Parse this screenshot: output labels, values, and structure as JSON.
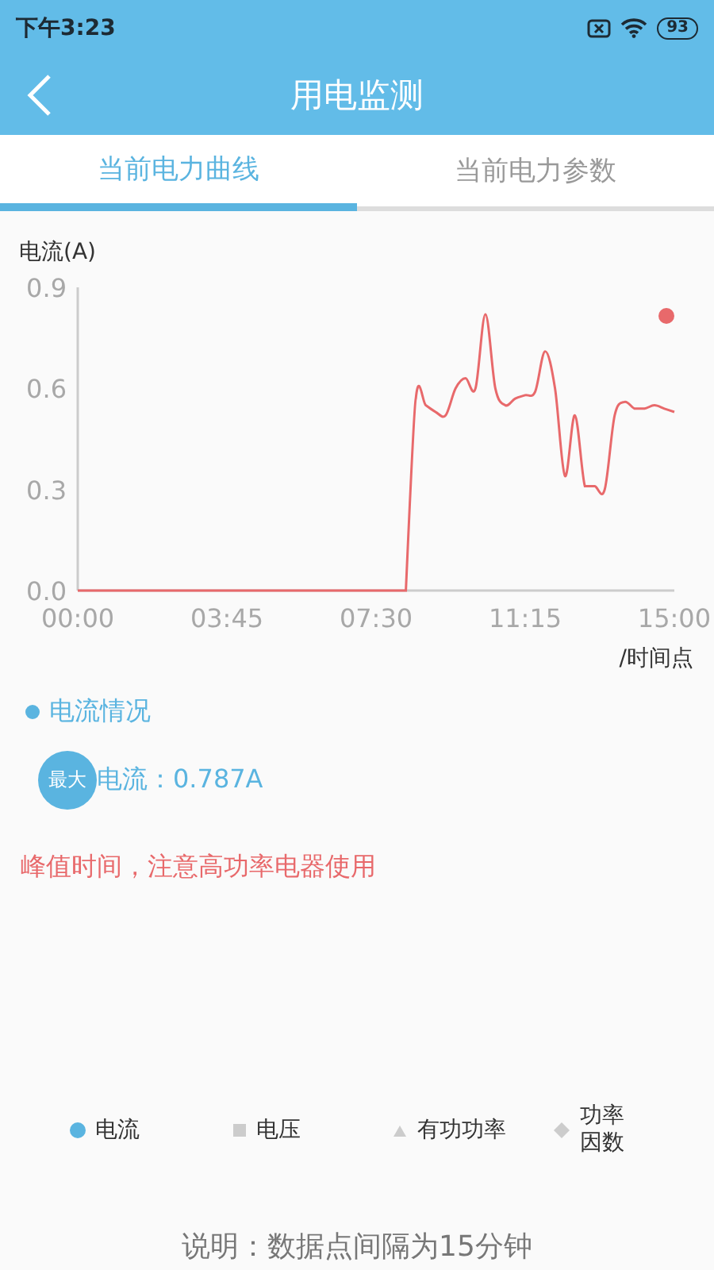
{
  "status_bar": {
    "time": "下午3:23",
    "battery": "93"
  },
  "header": {
    "title": "用电监测"
  },
  "tabs": [
    {
      "label": "当前电力曲线",
      "selected": true
    },
    {
      "label": "当前电力参数",
      "selected": false
    }
  ],
  "chart_data": {
    "type": "line",
    "ylabel": "电流(A)",
    "xlabel": "/时间点",
    "xlim": [
      0,
      15
    ],
    "ylim": [
      0,
      0.9
    ],
    "xticks": [
      {
        "value": 0,
        "label": "00:00"
      },
      {
        "value": 3.75,
        "label": "03:45"
      },
      {
        "value": 7.5,
        "label": "07:30"
      },
      {
        "value": 11.25,
        "label": "11:15"
      },
      {
        "value": 15,
        "label": "15:00"
      }
    ],
    "yticks": [
      {
        "value": 0,
        "label": "0.0"
      },
      {
        "value": 0.3,
        "label": "0.3"
      },
      {
        "value": 0.6,
        "label": "0.6"
      },
      {
        "value": 0.9,
        "label": "0.9"
      }
    ],
    "x": [
      0,
      0.25,
      0.5,
      0.75,
      1,
      1.25,
      1.5,
      1.75,
      2,
      2.25,
      2.5,
      2.75,
      3,
      3.25,
      3.5,
      3.75,
      4,
      4.25,
      4.5,
      4.75,
      5,
      5.25,
      5.5,
      5.75,
      6,
      6.25,
      6.5,
      6.75,
      7,
      7.25,
      7.5,
      7.75,
      8,
      8.25,
      8.5,
      8.75,
      9,
      9.25,
      9.5,
      9.75,
      10,
      10.25,
      10.5,
      10.75,
      11,
      11.25,
      11.5,
      11.75,
      12,
      12.25,
      12.5,
      12.75,
      13,
      13.25,
      13.5,
      13.75,
      14,
      14.25,
      14.5,
      14.75,
      15
    ],
    "series": [
      {
        "color": "#e8696b",
        "values": [
          0,
          0,
          0,
          0,
          0,
          0,
          0,
          0,
          0,
          0,
          0,
          0,
          0,
          0,
          0,
          0,
          0,
          0,
          0,
          0,
          0,
          0,
          0,
          0,
          0,
          0,
          0,
          0,
          0,
          0,
          0,
          0,
          0,
          0,
          0.57,
          0.55,
          0.53,
          0.52,
          0.6,
          0.63,
          0.6,
          0.82,
          0.6,
          0.55,
          0.57,
          0.58,
          0.59,
          0.71,
          0.6,
          0.34,
          0.52,
          0.31,
          0.31,
          0.3,
          0.52,
          0.56,
          0.54,
          0.54,
          0.55,
          0.54,
          0.53
        ]
      }
    ]
  },
  "summary": {
    "heading": "电流情况",
    "badge": "最大",
    "text": "电流：0.787A"
  },
  "warning": "峰值时间，注意高功率电器使用",
  "legend": [
    {
      "label": "电流",
      "kind": "circle",
      "selected": true
    },
    {
      "label": "电压",
      "kind": "square",
      "selected": false
    },
    {
      "label": "有功功率",
      "kind": "triangle",
      "selected": false
    },
    {
      "label": "功率因数",
      "kind": "diamond",
      "selected": false
    }
  ],
  "note": "说明：数据点间隔为15分钟"
}
